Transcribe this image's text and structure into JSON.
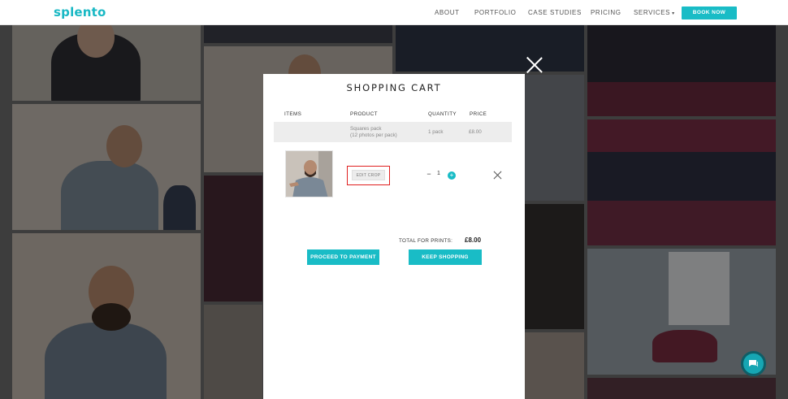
{
  "header": {
    "logo": "splento",
    "nav": {
      "about": "ABOUT",
      "portfolio": "PORTFOLIO",
      "case_studies": "CASE STUDIES",
      "pricing": "PRICING",
      "services": "SERVICES",
      "services_caret": "▾"
    },
    "book_now": "BOOK NOW"
  },
  "cart": {
    "title": "SHOPPING CART",
    "columns": {
      "items": "ITEMS",
      "product": "PRODUCT",
      "quantity": "QUANTITY",
      "price": "PRICE"
    },
    "pack": {
      "name": "Squares pack",
      "detail": "(12 photos per pack)",
      "quantity": "1 pack",
      "price": "£8.00"
    },
    "item": {
      "edit_label": "EDIT CROP",
      "minus": "−",
      "quantity": "1",
      "plus": "+"
    },
    "total_label": "TOTAL FOR PRINTS:",
    "total_value": "£8.00",
    "proceed_label": "PROCEED TO PAYMENT",
    "keep_label": "KEEP SHOPPING"
  },
  "icons": {
    "modal_close": "close-icon",
    "remove_item": "close-icon",
    "chat": "chat-icon"
  },
  "colors": {
    "brand": "#19bcc6",
    "highlight_outline": "#e02020"
  }
}
